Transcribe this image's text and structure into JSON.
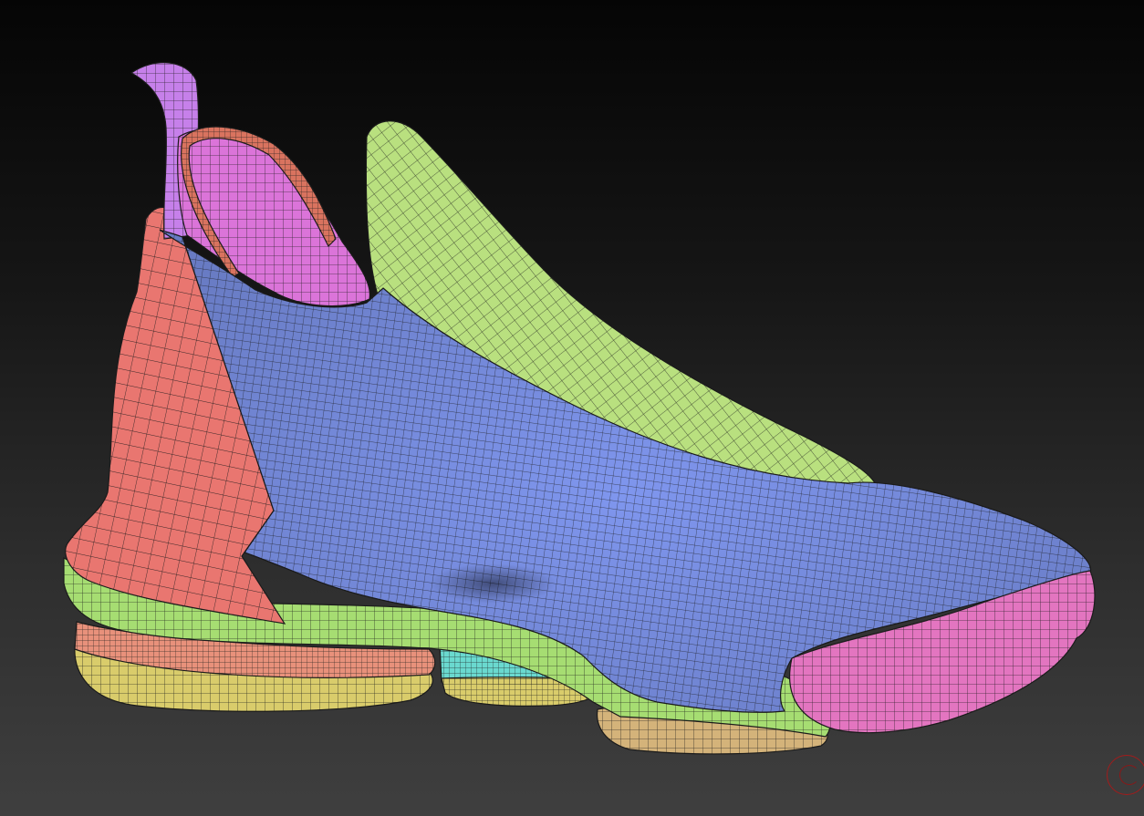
{
  "viewport": {
    "background_top": "#050505",
    "background_bottom": "#3f3f3f"
  },
  "polygroup_colors": {
    "upper": "#7f96ee",
    "tongue": "#b9e07f",
    "heel_panel": "#e97670",
    "collar_lining": "#db74d9",
    "pull_tab": "#c680ea",
    "collar_piping": "#d9735f",
    "toe_cap": "#e375c0",
    "midsole": "#a6dd72",
    "sole_band": "#e8917b",
    "outsole": "#d9cc6b",
    "air_unit": "#6ad9cf",
    "forefoot_outsole": "#d4b37a"
  },
  "wire_color": "#1b1b1b",
  "gizmo_color": "#a11c1c"
}
